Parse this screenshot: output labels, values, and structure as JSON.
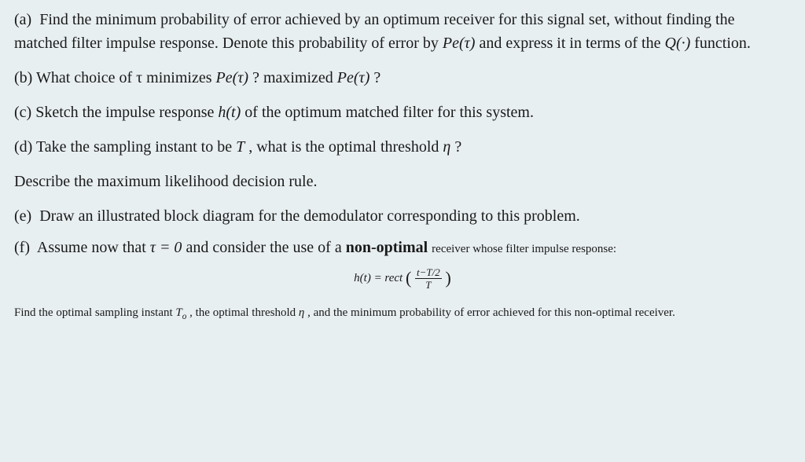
{
  "parts": {
    "a": {
      "label": "(a)",
      "text1": "Find the minimum probability of error achieved by an optimum receiver for this signal set, without finding the matched filter impulse response. Denote this probability of error by ",
      "pe": "Pe(τ)",
      "text2": " and express it in terms of the ",
      "q": "Q(·)",
      "text3": " function."
    },
    "b": {
      "label": "(b)",
      "text1": " What choice of τ minimizes ",
      "pe1": "Pe(τ)",
      "text2": "? maximized ",
      "pe2": "Pe(τ)",
      "text3": "?"
    },
    "c": {
      "label": "(c)",
      "text1": " Sketch the impulse response ",
      "ht": "h(t)",
      "text2": " of the optimum matched filter for this system."
    },
    "d": {
      "label": "(d)",
      "text1": " Take the sampling instant to be ",
      "T": "T",
      "text2": ", what is the optimal threshold ",
      "eta": "η",
      "text3": "?"
    },
    "d2": "Describe the maximum likelihood decision rule.",
    "e": {
      "label": "(e)",
      "text": "Draw an illustrated block diagram for the demodulator corresponding to this problem."
    },
    "f": {
      "label": "(f)",
      "text1": "Assume now that ",
      "tau": "τ = 0",
      "text2": " and consider the use of a ",
      "nonopt": "non-optimal",
      "text3": " receiver whose filter impulse response:"
    },
    "eq": {
      "lhs": "h(t) = rect ",
      "num": "t−T/2",
      "den": "T"
    },
    "f2": {
      "text1": "Find the optimal sampling instant ",
      "To": "T",
      "To_sub": "o",
      "text2": ", the optimal threshold ",
      "eta": "η",
      "text3": ", and the minimum probability of error achieved for this non-optimal receiver."
    }
  }
}
